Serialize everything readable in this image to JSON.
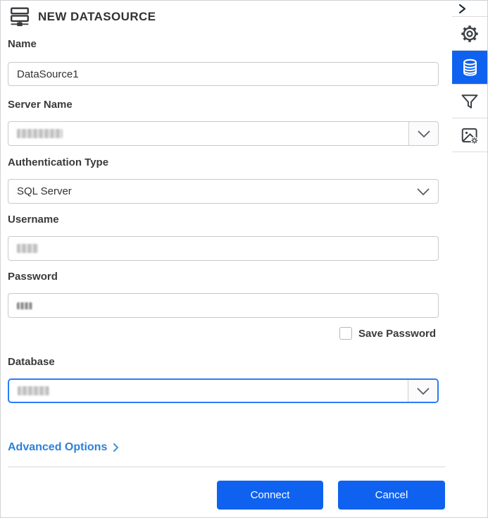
{
  "panel": {
    "title": "NEW DATASOURCE",
    "header_icon": "datasource-server-icon",
    "fields": {
      "name": {
        "label": "Name",
        "value": "DataSource1"
      },
      "server_name": {
        "label": "Server Name",
        "value_hidden": true,
        "type": "combobox"
      },
      "auth_type": {
        "label": "Authentication Type",
        "value": "SQL Server",
        "type": "dropdown"
      },
      "username": {
        "label": "Username",
        "value_hidden": true
      },
      "password": {
        "label": "Password",
        "value_hidden": true,
        "masked": true
      },
      "save_password": {
        "label": "Save Password",
        "checked": false
      },
      "database": {
        "label": "Database",
        "value_hidden": true,
        "type": "combobox",
        "focused": true
      }
    },
    "advanced_options_label": "Advanced Options",
    "buttons": {
      "connect": "Connect",
      "cancel": "Cancel"
    }
  },
  "sidebar": {
    "collapse_icon": "chevron-right-icon",
    "items": [
      {
        "name": "settings",
        "icon": "gear-icon",
        "selected": false
      },
      {
        "name": "datasource",
        "icon": "database-icon",
        "selected": true
      },
      {
        "name": "filter",
        "icon": "filter-icon",
        "selected": false
      },
      {
        "name": "image-settings",
        "icon": "image-gear-icon",
        "selected": false
      }
    ]
  },
  "colors": {
    "accent": "#0f62f0",
    "focus_border": "#2b7cf7",
    "link": "#2d80da",
    "text": "#333333",
    "input_border": "#c8c9cb"
  }
}
